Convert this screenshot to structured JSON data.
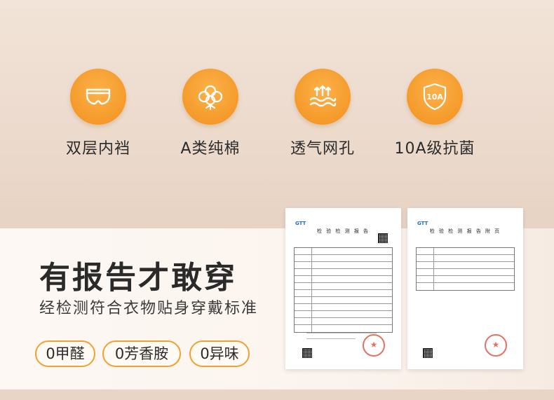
{
  "features": [
    {
      "icon": "double-layer-briefs-icon",
      "label": "双层内裆"
    },
    {
      "icon": "cotton-icon",
      "label": "A类纯棉"
    },
    {
      "icon": "breathable-waves-icon",
      "label": "透气网孔"
    },
    {
      "icon": "antibacterial-10a-icon",
      "label": "10A级抗菌",
      "icon_text": "10A"
    }
  ],
  "headline": "有报告才敢穿",
  "subline": "经检测符合衣物贴身穿戴标准",
  "badges": [
    "0甲醛",
    "0芳香胺",
    "0异味"
  ],
  "reports": [
    {
      "title": "检 验 检 测 报 告"
    },
    {
      "title": "检 验 检 测 报 告 附 页"
    }
  ],
  "colors": {
    "accent_orange": "#f59a2a",
    "badge_border": "#f0a133",
    "top_background": "#e9d5c6",
    "stamp_red": "#e05a4a"
  }
}
